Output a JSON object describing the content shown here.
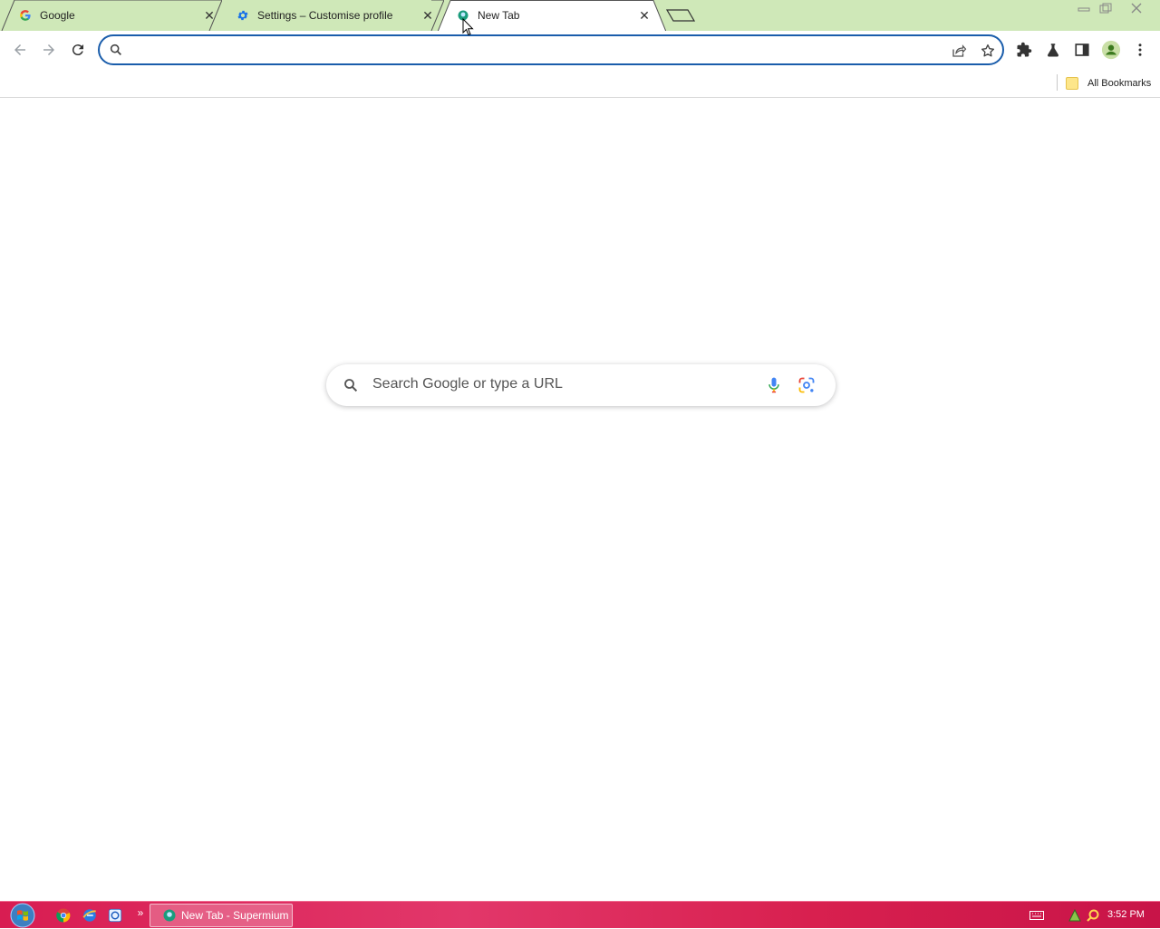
{
  "tabs": [
    {
      "title": "Google",
      "icon": "google-icon"
    },
    {
      "title": "Settings – Customise profile",
      "icon": "gear-icon"
    },
    {
      "title": "New Tab",
      "icon": "supermium-icon",
      "active": true
    }
  ],
  "omnibox": {
    "value": "",
    "placeholder": ""
  },
  "bookmarks": {
    "all_bookmarks": "All Bookmarks"
  },
  "ntp": {
    "search_placeholder": "Search Google or type a URL"
  },
  "taskbar": {
    "active_window": "New Tab - Supermium",
    "clock": "3:52 PM",
    "overflow": "»"
  },
  "colors": {
    "tabstrip": "#cfe8b8",
    "omnibox_border": "#1a5dab",
    "taskbar": "#d81d52"
  }
}
